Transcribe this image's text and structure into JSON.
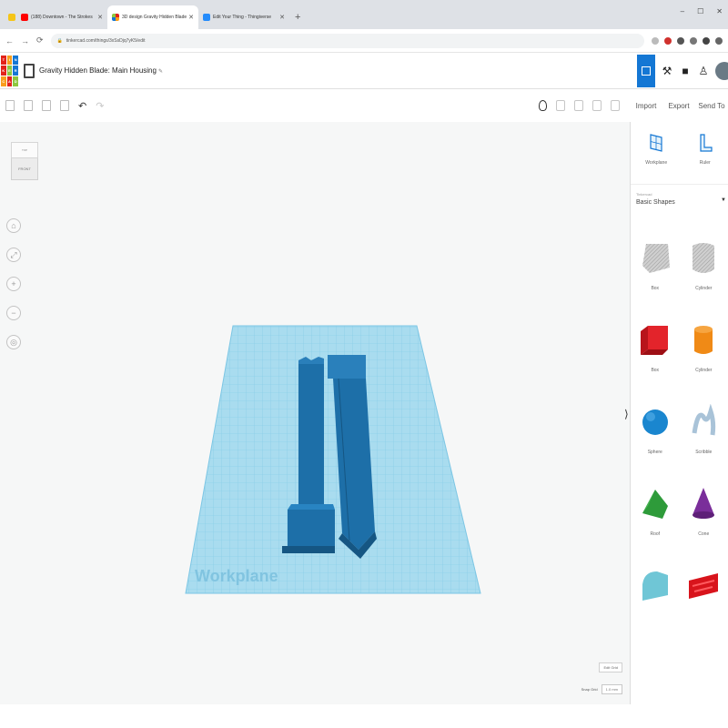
{
  "browser": {
    "tabs": [
      {
        "title": "",
        "favicon_color": "#f5c518",
        "active": false,
        "small": true
      },
      {
        "title": "(188) Downtown - The Strokes",
        "favicon_color": "#ff0000",
        "active": false
      },
      {
        "title": "3D design Gravity Hidden Blade",
        "favicon_color": "#ffffff",
        "active": true
      },
      {
        "title": "Edit Your Thing - Thingiverse",
        "favicon_color": "#248bfb",
        "active": false
      }
    ],
    "new_tab": "+",
    "window_controls": [
      "–",
      "☐",
      "✕"
    ],
    "url": "tinkercad.com/things/3xSsDjq7yK5/edit"
  },
  "app": {
    "logo_letters": [
      "T",
      "I",
      "N",
      "K",
      "E",
      "R",
      "C",
      "A",
      "D"
    ],
    "logo_colors": [
      "#e2231a",
      "#f99d1c",
      "#1477d4",
      "#e2231a",
      "#8dc63f",
      "#1477d4",
      "#f99d1c",
      "#e2231a",
      "#8dc63f"
    ],
    "project_title": "Gravity Hidden Blade: Main Housing",
    "edit_hint": "Edit"
  },
  "toolbar": {
    "undo": "↶",
    "redo": "↷",
    "import": "Import",
    "export": "Export",
    "send_to": "Send To"
  },
  "canvas": {
    "viewcube_top": "TOP",
    "viewcube_front": "FRONT",
    "nav_controls": [
      "home",
      "fit",
      "+",
      "−",
      "orthographic"
    ],
    "workplane_label": "Workplane",
    "edit_grid": "Edit Grid",
    "snap_grid_label": "Snap Grid",
    "snap_grid_value": "1.0 mm"
  },
  "panel": {
    "tools": [
      {
        "label": "Workplane",
        "icon": "workplane-icon"
      },
      {
        "label": "Ruler",
        "icon": "ruler-icon"
      }
    ],
    "library_caption": "Tinkercad",
    "library_name": "Basic Shapes",
    "shapes": [
      {
        "label": "Box",
        "icon": "box-hole-icon"
      },
      {
        "label": "Cylinder",
        "icon": "cylinder-hole-icon"
      },
      {
        "label": "Box",
        "icon": "box-icon"
      },
      {
        "label": "Cylinder",
        "icon": "cylinder-icon"
      },
      {
        "label": "Sphere",
        "icon": "sphere-icon"
      },
      {
        "label": "Scribble",
        "icon": "scribble-icon"
      },
      {
        "label": "Roof",
        "icon": "roof-icon"
      },
      {
        "label": "Cone",
        "icon": "cone-icon"
      },
      {
        "label": "",
        "icon": "round-roof-icon"
      },
      {
        "label": "",
        "icon": "text-icon"
      }
    ]
  },
  "colors": {
    "accent": "#1477d4",
    "workplane": "#9fd6ec",
    "workplane_line": "#6cbde0",
    "part": "#1d6fa8",
    "part_dark": "#155683"
  }
}
